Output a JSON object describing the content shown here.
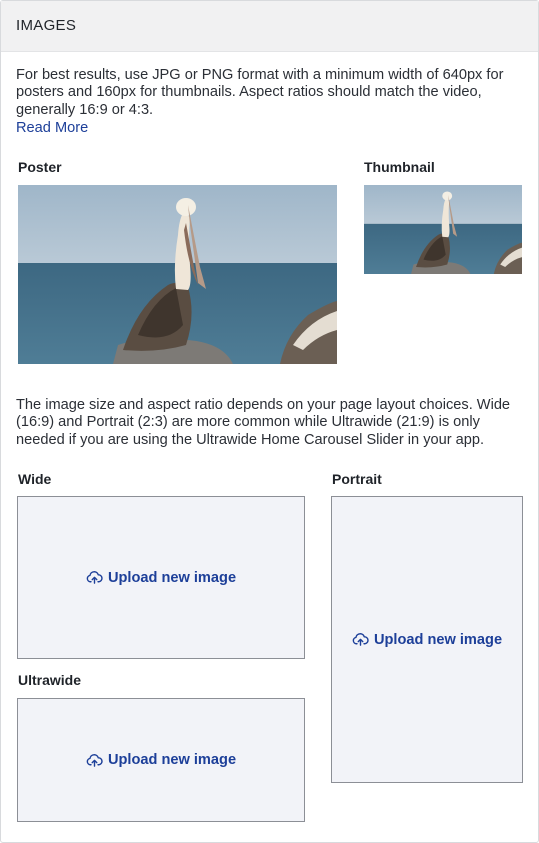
{
  "header": {
    "title": "IMAGES"
  },
  "intro": {
    "text": "For best results, use JPG or PNG format with a minimum width of 640px for posters and 160px for thumbnails. Aspect ratios should match the video, generally 16:9 or 4:3.",
    "read_more": "Read More"
  },
  "poster": {
    "label": "Poster",
    "image": "pelican-on-rock-photo"
  },
  "thumbnail": {
    "label": "Thumbnail",
    "image": "pelican-on-rock-photo"
  },
  "layout_note": "The image size and aspect ratio depends on your page layout choices. Wide (16:9) and Portrait (2:3) are more common while Ultrawide (21:9) is only needed if you are using the Ultrawide Home Carousel Slider in your app.",
  "wide": {
    "label": "Wide",
    "upload_label": "Upload new image",
    "icon": "upload-cloud-icon"
  },
  "portrait": {
    "label": "Portrait",
    "upload_label": "Upload new image",
    "icon": "upload-cloud-icon"
  },
  "ultrawide": {
    "label": "Ultrawide",
    "upload_label": "Upload new image",
    "icon": "upload-cloud-icon"
  },
  "colors": {
    "link": "#1d3f99",
    "upload_bg": "#f2f3f8",
    "header_bg": "#f1f1f2"
  }
}
